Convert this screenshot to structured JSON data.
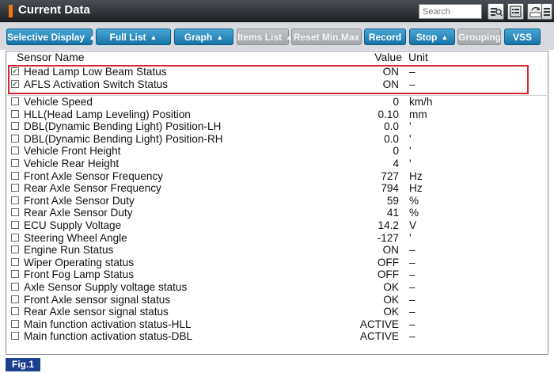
{
  "window": {
    "title": "Current Data",
    "search_placeholder": "Search"
  },
  "toolbar": {
    "buttons": [
      {
        "label": "Selective Display",
        "dropdown": true,
        "enabled": true
      },
      {
        "label": "Full List",
        "dropdown": true,
        "enabled": true
      },
      {
        "label": "Graph",
        "dropdown": true,
        "enabled": true
      },
      {
        "label": "Items List",
        "dropdown": true,
        "enabled": false
      },
      {
        "label": "Reset Min.Max",
        "dropdown": false,
        "enabled": false
      },
      {
        "label": "Record",
        "dropdown": false,
        "enabled": true
      },
      {
        "label": "Stop",
        "dropdown": true,
        "enabled": true
      },
      {
        "label": "Grouping",
        "dropdown": false,
        "enabled": false
      },
      {
        "label": "VSS",
        "dropdown": false,
        "enabled": true
      }
    ]
  },
  "table": {
    "headers": {
      "name": "Sensor Name",
      "value": "Value",
      "unit": "Unit"
    },
    "selected_rows": [
      {
        "name": "Head Lamp Low Beam Status",
        "value": "ON",
        "unit": "–",
        "checked": true
      },
      {
        "name": "AFLS Activation Switch Status",
        "value": "ON",
        "unit": "–",
        "checked": true
      }
    ],
    "rows": [
      {
        "name": "Vehicle Speed",
        "value": "0",
        "unit": "km/h"
      },
      {
        "name": "HLL(Head Lamp Leveling) Position",
        "value": "0.10",
        "unit": "mm"
      },
      {
        "name": "DBL(Dynamic Bending Light) Position-LH",
        "value": "0.0",
        "unit": "'"
      },
      {
        "name": "DBL(Dynamic Bending Light) Position-RH",
        "value": "0.0",
        "unit": "'"
      },
      {
        "name": "Vehicle Front Height",
        "value": "0",
        "unit": "'"
      },
      {
        "name": "Vehicle Rear Height",
        "value": "4",
        "unit": "'"
      },
      {
        "name": "Front Axle Sensor Frequency",
        "value": "727",
        "unit": "Hz"
      },
      {
        "name": "Rear Axle Sensor Frequency",
        "value": "794",
        "unit": "Hz"
      },
      {
        "name": "Front Axle Sensor Duty",
        "value": "59",
        "unit": "%"
      },
      {
        "name": "Rear Axle Sensor Duty",
        "value": "41",
        "unit": "%"
      },
      {
        "name": "ECU Supply Voltage",
        "value": "14.2",
        "unit": "V"
      },
      {
        "name": "Steering Wheel Angle",
        "value": "-127",
        "unit": "'"
      },
      {
        "name": "Engine Run Status",
        "value": "ON",
        "unit": "–"
      },
      {
        "name": "Wiper Operating status",
        "value": "OFF",
        "unit": "–"
      },
      {
        "name": "Front Fog Lamp Status",
        "value": "OFF",
        "unit": "–"
      },
      {
        "name": "Axle Sensor Supply voltage status",
        "value": "OK",
        "unit": "–"
      },
      {
        "name": "Front Axle sensor signal status",
        "value": "OK",
        "unit": "–"
      },
      {
        "name": "Rear Axle sensor signal status",
        "value": "OK",
        "unit": "–"
      },
      {
        "name": "Main function activation status-HLL",
        "value": "ACTIVE",
        "unit": "–"
      },
      {
        "name": "Main function activation status-DBL",
        "value": "ACTIVE",
        "unit": "–"
      }
    ]
  },
  "figure_label": "Fig.1",
  "colors": {
    "accent": "#f07a10",
    "button": "#1773a6",
    "highlight": "#d8242f",
    "figure_badge": "#1c3f8f"
  },
  "icons": [
    "search-list-icon",
    "list-view-icon",
    "retry-icon",
    "menu-icon"
  ]
}
